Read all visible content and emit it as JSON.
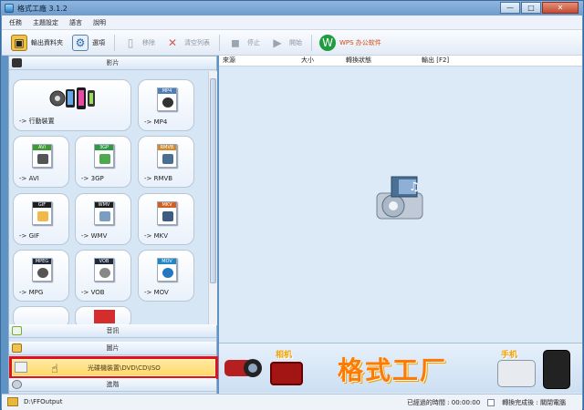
{
  "window": {
    "title": "格式工廠 3.1.2",
    "controls": [
      "—",
      "□",
      "✕"
    ]
  },
  "menu": [
    "任務",
    "主題設定",
    "語言",
    "說明"
  ],
  "toolbar": [
    {
      "label": "輸出資料夾",
      "icon": "folder-icon",
      "enabled": true
    },
    {
      "label": "選項",
      "icon": "options-icon",
      "enabled": true
    },
    {
      "label": "移除",
      "icon": "remove-icon",
      "enabled": false
    },
    {
      "label": "清空列表",
      "icon": "clear-list-icon",
      "enabled": false
    },
    {
      "label": "停止",
      "icon": "stop-icon",
      "enabled": false
    },
    {
      "label": "開始",
      "icon": "start-icon",
      "enabled": false
    },
    {
      "label": "WPS 办公软件",
      "icon": "wps-icon",
      "enabled": true
    }
  ],
  "left_panel": {
    "video_header": "影片",
    "tiles": [
      {
        "label": "-> 行動裝置",
        "icon": "mobile-device-icon"
      },
      {
        "label": "-> MP4",
        "icon_label": "MP4",
        "icon": "mp4-file-icon",
        "color": "#4d7fb7"
      },
      {
        "label": "-> AVI",
        "icon_label": "AVI",
        "icon": "avi-file-icon",
        "color": "#3f9a31"
      },
      {
        "label": "-> 3GP",
        "icon_label": "3GP",
        "icon": "3gp-file-icon",
        "color": "#2f9a43"
      },
      {
        "label": "-> RMVB",
        "icon_label": "RMVB",
        "icon": "rmvb-file-icon",
        "color": "#d18a2d"
      },
      {
        "label": "-> GIF",
        "icon_label": "GIF",
        "icon": "gif-file-icon",
        "color": "#1f1f1f"
      },
      {
        "label": "-> WMV",
        "icon_label": "WMV",
        "icon": "wmv-file-icon",
        "color": "#1e1e1e"
      },
      {
        "label": "-> MKV",
        "icon_label": "MKV",
        "icon": "mkv-file-icon",
        "color": "#d25f1f"
      },
      {
        "label": "-> MPG",
        "icon_label": "MPEG",
        "icon": "mpeg-file-icon",
        "color": "#1f2a3d"
      },
      {
        "label": "-> VOB",
        "icon_label": "VOB",
        "icon": "vob-file-icon",
        "color": "#1f2a3d"
      },
      {
        "label": "-> MOV",
        "icon_label": "MOV",
        "icon": "mov-file-icon",
        "color": "#1e86c9"
      }
    ],
    "audio_header": "音訊",
    "image_header": "圖片",
    "rom_item": "光碟機裝置\\DVD\\CD\\ISO",
    "advanced_header": "進階"
  },
  "table": {
    "columns": [
      "來源",
      "大小",
      "轉換狀態",
      "輸出 [F2]"
    ]
  },
  "banner": {
    "title": "格式工厂",
    "badge_left": "相机",
    "badge_right": "手机"
  },
  "status": {
    "path": "D:\\FFOutput",
    "elapsed": "已經過的時間 : 00:00:00",
    "after_convert": "轉換完成後 : 關閉電腦"
  }
}
